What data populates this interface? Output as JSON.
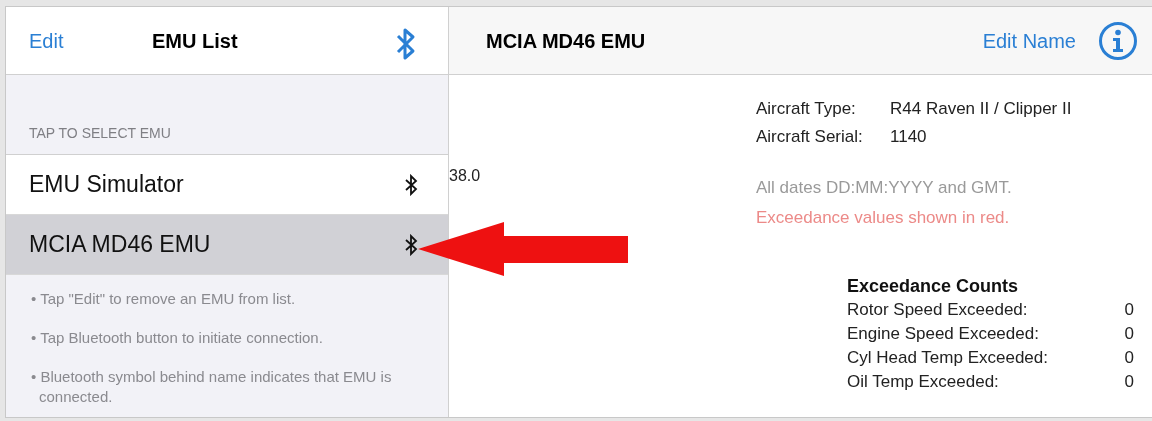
{
  "left_header": {
    "edit": "Edit",
    "title": "EMU List"
  },
  "section_header": "TAP TO SELECT EMU",
  "emus": [
    {
      "name": "EMU Simulator",
      "selected": false
    },
    {
      "name": "MCIA MD46 EMU",
      "selected": true
    }
  ],
  "help": [
    "• Tap \"Edit\" to remove an EMU from list.",
    "• Tap Bluetooth button to initiate connection.",
    "• Bluetooth symbol behind name indicates that EMU is connected."
  ],
  "right_header": {
    "title": "MCIA MD46 EMU",
    "edit_name": "Edit Name"
  },
  "side_value": "38.0",
  "aircraft": [
    {
      "label": "Aircraft Type:",
      "value": "R44 Raven II / Clipper II"
    },
    {
      "label": "Aircraft Serial:",
      "value": "1140"
    }
  ],
  "notes": [
    {
      "text": "All dates DD:MM:YYYY and GMT.",
      "kind": "plain"
    },
    {
      "text": "Exceedance values shown in red.",
      "kind": "red"
    }
  ],
  "exceedance": {
    "title": "Exceedance Counts",
    "rows": [
      {
        "label": "Rotor Speed Exceeded:",
        "value": "0"
      },
      {
        "label": "Engine Speed Exceeded:",
        "value": "0"
      },
      {
        "label": "Cyl Head Temp Exceeded:",
        "value": "0"
      },
      {
        "label": "Oil Temp Exceeded:",
        "value": "0"
      }
    ]
  }
}
